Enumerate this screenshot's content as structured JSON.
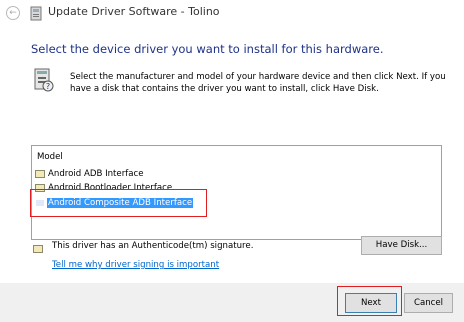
{
  "window": {
    "title": "Update Driver Software - Tolino",
    "back_glyph": "←"
  },
  "main": {
    "heading": "Select the device driver you want to install for this hardware.",
    "description": "Select the manufacturer and model of your hardware device and then click Next. If you have a disk that contains the driver you want to install, click Have Disk."
  },
  "model_list": {
    "header": "Model",
    "items": [
      {
        "label": "Android ADB Interface",
        "selected": false
      },
      {
        "label": "Android Bootloader Interface",
        "selected": false
      },
      {
        "label": "Android Composite ADB Interface",
        "selected": true
      }
    ]
  },
  "signature": {
    "text": "This driver has an Authenticode(tm) signature.",
    "link": "Tell me why driver signing is important"
  },
  "buttons": {
    "have_disk": "Have Disk...",
    "next": "Next",
    "cancel": "Cancel"
  },
  "colors": {
    "heading": "#1e3287",
    "selection": "#3399ff",
    "link": "#0066cc",
    "annotation": "#e02020"
  },
  "icons": {
    "back": "back-arrow-icon",
    "title": "device-manager-icon",
    "hardware": "hardware-device-icon",
    "list_item": "driver-icon",
    "signature": "signature-icon"
  }
}
